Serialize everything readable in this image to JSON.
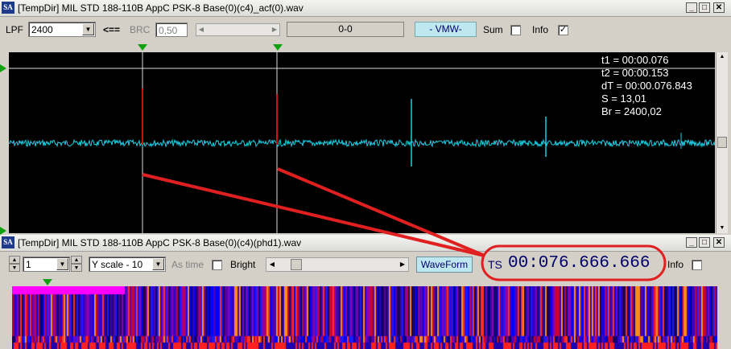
{
  "window1": {
    "title": "[TempDir] MIL STD 188-110B AppC PSK-8 Base(0)(c4)_acf(0).wav",
    "app_icon": "SA",
    "toolbar": {
      "lpf_label": "LPF",
      "lpf_value": "2400",
      "arrow_label": "<==",
      "brc_label": "BRC",
      "brc_value": "0,50",
      "range_value": "0-0",
      "vmw_label": "- VMW-",
      "sum_label": "Sum",
      "sum_checked": false,
      "info_label": "Info",
      "info_checked": true,
      "check_mark": "✓"
    },
    "readout": {
      "t1": "t1 = 00:00.076",
      "t2": "t2 = 00:00.153",
      "dt": "dT = 00:00.076.843",
      "s": "S = 13,01",
      "br": "Br = 2400,02"
    },
    "colors": {
      "waveform": "#1ecfe6",
      "background": "#000000",
      "marker": "#10a010",
      "peak": "#cc1111"
    }
  },
  "window2": {
    "title": "[TempDir] MIL STD 188-110B AppC PSK-8 Base(0)(c4)(phd1).wav",
    "app_icon": "SA",
    "toolbar": {
      "spin_value": "1",
      "yscale_value": "Y scale - 10",
      "as_time_label": "As time",
      "bright_label": "Bright",
      "waveform_button": "WaveForm",
      "ts_label": "TS",
      "ts_value": "00:076.666.666",
      "info_label": "Info"
    }
  },
  "annotation_color": "#e02020",
  "window_buttons": {
    "minimize": "_",
    "maximize": "□",
    "close": "✕"
  }
}
